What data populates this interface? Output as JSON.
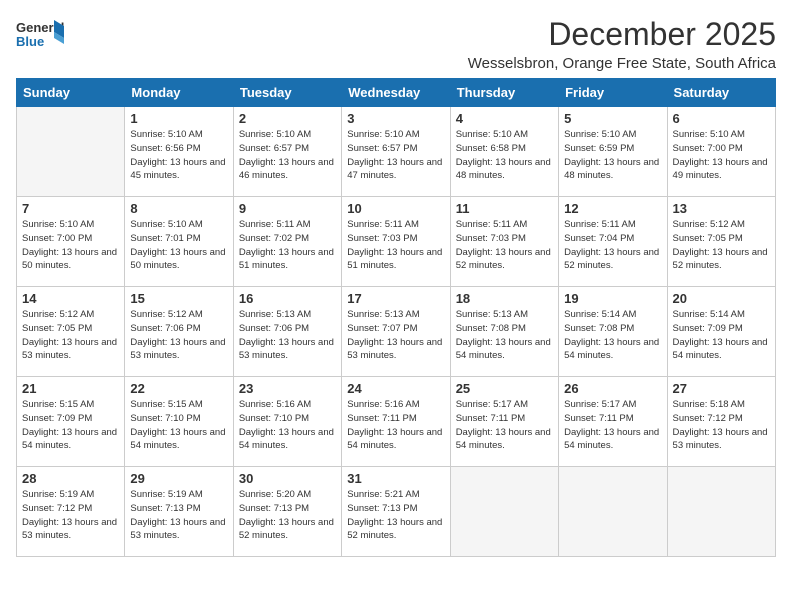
{
  "logo": {
    "line1": "General",
    "line2": "Blue"
  },
  "title": "December 2025",
  "location": "Wesselsbron, Orange Free State, South Africa",
  "headers": [
    "Sunday",
    "Monday",
    "Tuesday",
    "Wednesday",
    "Thursday",
    "Friday",
    "Saturday"
  ],
  "weeks": [
    [
      {
        "day": "",
        "info": ""
      },
      {
        "day": "1",
        "info": "Sunrise: 5:10 AM\nSunset: 6:56 PM\nDaylight: 13 hours\nand 45 minutes."
      },
      {
        "day": "2",
        "info": "Sunrise: 5:10 AM\nSunset: 6:57 PM\nDaylight: 13 hours\nand 46 minutes."
      },
      {
        "day": "3",
        "info": "Sunrise: 5:10 AM\nSunset: 6:57 PM\nDaylight: 13 hours\nand 47 minutes."
      },
      {
        "day": "4",
        "info": "Sunrise: 5:10 AM\nSunset: 6:58 PM\nDaylight: 13 hours\nand 48 minutes."
      },
      {
        "day": "5",
        "info": "Sunrise: 5:10 AM\nSunset: 6:59 PM\nDaylight: 13 hours\nand 48 minutes."
      },
      {
        "day": "6",
        "info": "Sunrise: 5:10 AM\nSunset: 7:00 PM\nDaylight: 13 hours\nand 49 minutes."
      }
    ],
    [
      {
        "day": "7",
        "info": "Sunrise: 5:10 AM\nSunset: 7:00 PM\nDaylight: 13 hours\nand 50 minutes."
      },
      {
        "day": "8",
        "info": "Sunrise: 5:10 AM\nSunset: 7:01 PM\nDaylight: 13 hours\nand 50 minutes."
      },
      {
        "day": "9",
        "info": "Sunrise: 5:11 AM\nSunset: 7:02 PM\nDaylight: 13 hours\nand 51 minutes."
      },
      {
        "day": "10",
        "info": "Sunrise: 5:11 AM\nSunset: 7:03 PM\nDaylight: 13 hours\nand 51 minutes."
      },
      {
        "day": "11",
        "info": "Sunrise: 5:11 AM\nSunset: 7:03 PM\nDaylight: 13 hours\nand 52 minutes."
      },
      {
        "day": "12",
        "info": "Sunrise: 5:11 AM\nSunset: 7:04 PM\nDaylight: 13 hours\nand 52 minutes."
      },
      {
        "day": "13",
        "info": "Sunrise: 5:12 AM\nSunset: 7:05 PM\nDaylight: 13 hours\nand 52 minutes."
      }
    ],
    [
      {
        "day": "14",
        "info": "Sunrise: 5:12 AM\nSunset: 7:05 PM\nDaylight: 13 hours\nand 53 minutes."
      },
      {
        "day": "15",
        "info": "Sunrise: 5:12 AM\nSunset: 7:06 PM\nDaylight: 13 hours\nand 53 minutes."
      },
      {
        "day": "16",
        "info": "Sunrise: 5:13 AM\nSunset: 7:06 PM\nDaylight: 13 hours\nand 53 minutes."
      },
      {
        "day": "17",
        "info": "Sunrise: 5:13 AM\nSunset: 7:07 PM\nDaylight: 13 hours\nand 53 minutes."
      },
      {
        "day": "18",
        "info": "Sunrise: 5:13 AM\nSunset: 7:08 PM\nDaylight: 13 hours\nand 54 minutes."
      },
      {
        "day": "19",
        "info": "Sunrise: 5:14 AM\nSunset: 7:08 PM\nDaylight: 13 hours\nand 54 minutes."
      },
      {
        "day": "20",
        "info": "Sunrise: 5:14 AM\nSunset: 7:09 PM\nDaylight: 13 hours\nand 54 minutes."
      }
    ],
    [
      {
        "day": "21",
        "info": "Sunrise: 5:15 AM\nSunset: 7:09 PM\nDaylight: 13 hours\nand 54 minutes."
      },
      {
        "day": "22",
        "info": "Sunrise: 5:15 AM\nSunset: 7:10 PM\nDaylight: 13 hours\nand 54 minutes."
      },
      {
        "day": "23",
        "info": "Sunrise: 5:16 AM\nSunset: 7:10 PM\nDaylight: 13 hours\nand 54 minutes."
      },
      {
        "day": "24",
        "info": "Sunrise: 5:16 AM\nSunset: 7:11 PM\nDaylight: 13 hours\nand 54 minutes."
      },
      {
        "day": "25",
        "info": "Sunrise: 5:17 AM\nSunset: 7:11 PM\nDaylight: 13 hours\nand 54 minutes."
      },
      {
        "day": "26",
        "info": "Sunrise: 5:17 AM\nSunset: 7:11 PM\nDaylight: 13 hours\nand 54 minutes."
      },
      {
        "day": "27",
        "info": "Sunrise: 5:18 AM\nSunset: 7:12 PM\nDaylight: 13 hours\nand 53 minutes."
      }
    ],
    [
      {
        "day": "28",
        "info": "Sunrise: 5:19 AM\nSunset: 7:12 PM\nDaylight: 13 hours\nand 53 minutes."
      },
      {
        "day": "29",
        "info": "Sunrise: 5:19 AM\nSunset: 7:13 PM\nDaylight: 13 hours\nand 53 minutes."
      },
      {
        "day": "30",
        "info": "Sunrise: 5:20 AM\nSunset: 7:13 PM\nDaylight: 13 hours\nand 52 minutes."
      },
      {
        "day": "31",
        "info": "Sunrise: 5:21 AM\nSunset: 7:13 PM\nDaylight: 13 hours\nand 52 minutes."
      },
      {
        "day": "",
        "info": ""
      },
      {
        "day": "",
        "info": ""
      },
      {
        "day": "",
        "info": ""
      }
    ]
  ]
}
